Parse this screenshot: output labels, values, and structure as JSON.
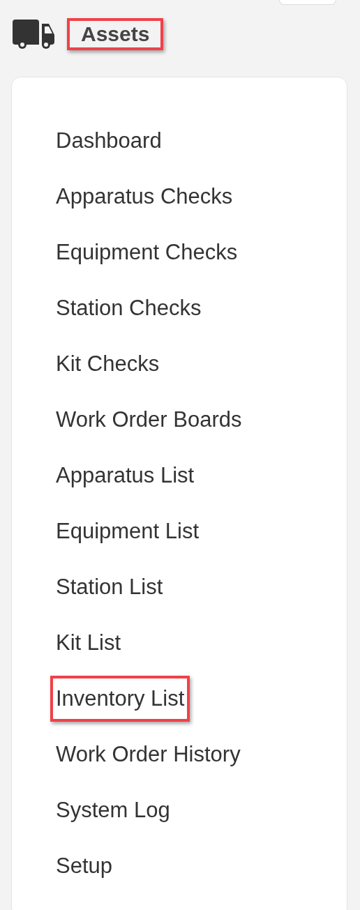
{
  "header": {
    "title": "Assets",
    "highlighted": true
  },
  "menu": {
    "items": [
      {
        "label": "Dashboard",
        "highlighted": false
      },
      {
        "label": "Apparatus Checks",
        "highlighted": false
      },
      {
        "label": "Equipment Checks",
        "highlighted": false
      },
      {
        "label": "Station Checks",
        "highlighted": false
      },
      {
        "label": "Kit Checks",
        "highlighted": false
      },
      {
        "label": "Work Order Boards",
        "highlighted": false
      },
      {
        "label": "Apparatus List",
        "highlighted": false
      },
      {
        "label": "Equipment List",
        "highlighted": false
      },
      {
        "label": "Station List",
        "highlighted": false
      },
      {
        "label": "Kit List",
        "highlighted": false
      },
      {
        "label": "Inventory List",
        "highlighted": true
      },
      {
        "label": "Work Order History",
        "highlighted": false
      },
      {
        "label": "System Log",
        "highlighted": false
      },
      {
        "label": "Setup",
        "highlighted": false
      }
    ]
  }
}
